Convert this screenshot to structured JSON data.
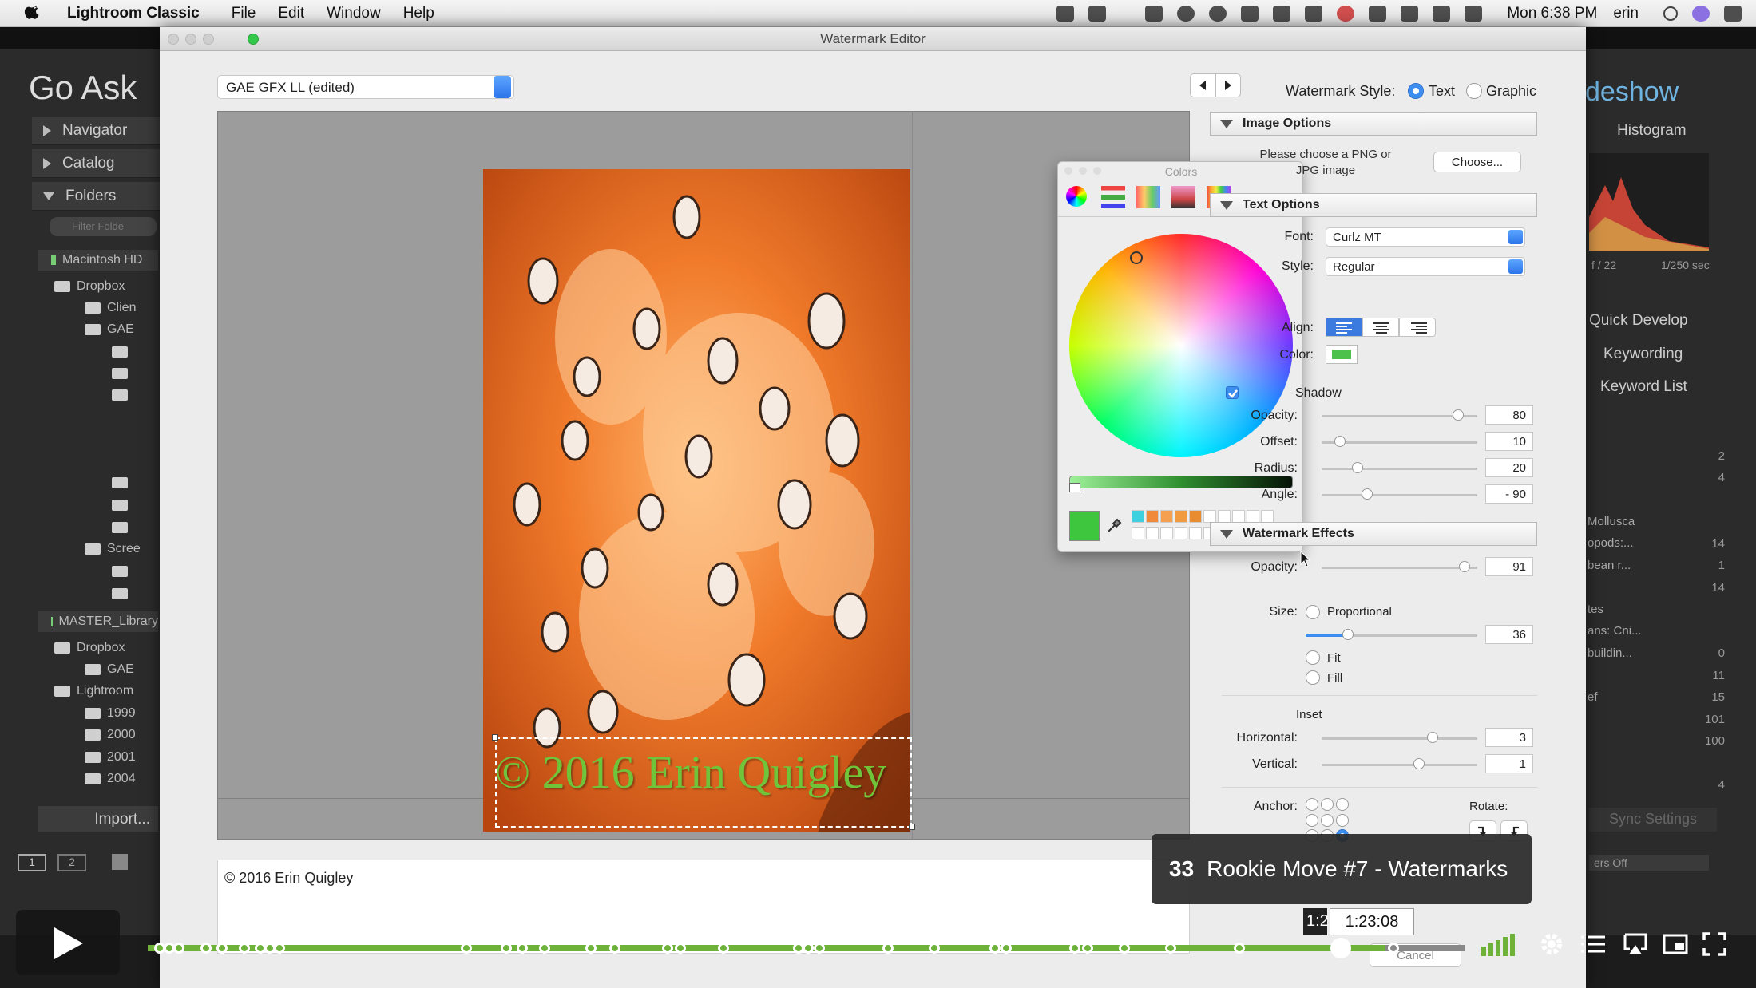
{
  "menubar": {
    "app_name": "Lightroom Classic",
    "items": [
      "File",
      "Edit",
      "Window",
      "Help"
    ],
    "clock": "Mon 6:38 PM",
    "user": "erin"
  },
  "lightroom": {
    "identity_plate": "Go Ask",
    "module_right": "deshow",
    "left_panels": [
      "Navigator",
      "Catalog",
      "Folders"
    ],
    "filter_placeholder": "Filter Folde",
    "volumes": [
      "Macintosh HD",
      "MASTER_Library"
    ],
    "tree": [
      "Dropbox",
      "Clien",
      "GAE",
      "Scree",
      "Dropbox",
      "GAE",
      "Lightroom",
      "1999",
      "2000",
      "2001",
      "2004"
    ],
    "import_label": "Import...",
    "right_panels": [
      "Histogram",
      "Quick Develop",
      "Keywording",
      "Keyword List"
    ],
    "histogram_info": [
      "f / 22",
      "1/250 sec"
    ],
    "keyword_labels": [
      "Mollusca",
      "opods:...",
      "bean r...",
      "tes",
      "ans: Cni...",
      "buildin...",
      "ef"
    ],
    "keyword_counts": [
      "2",
      "4",
      "14",
      "1",
      "14",
      "0",
      "11",
      "15",
      "101",
      "100",
      "4"
    ],
    "sync_label": "Sync Settings",
    "filter_off": "ers Off",
    "filmstrip_pages": [
      "1",
      "2"
    ]
  },
  "dialog": {
    "title": "Watermark Editor",
    "preset": "GAE GFX LL (edited)",
    "watermark_style_label": "Watermark Style:",
    "style_text": "Text",
    "style_graphic": "Graphic",
    "style_selected": "Text",
    "watermark_text": "© 2016 Erin Quigley",
    "caption_value": "© 2016 Erin Quigley",
    "cancel_label": "Cancel"
  },
  "colors_panel": {
    "title": "Colors",
    "current_color": "#3ec63e",
    "swatches": [
      "#3fd0e0",
      "#f08a3a",
      "#f5a050",
      "#f29a40",
      "#e98c30"
    ]
  },
  "image_options": {
    "header": "Image Options",
    "prompt": "Please choose a PNG or JPG image",
    "choose_label": "Choose..."
  },
  "text_options": {
    "header": "Text Options",
    "font_label": "Font:",
    "font_value": "Curlz MT",
    "style_label": "Style:",
    "style_value": "Regular",
    "align_label": "Align:",
    "color_label": "Color:",
    "color_value": "#4cc24c",
    "shadow_label": "Shadow",
    "shadow_checked": true,
    "shadow": [
      {
        "label": "Opacity:",
        "value": "80"
      },
      {
        "label": "Offset:",
        "value": "10"
      },
      {
        "label": "Radius:",
        "value": "20"
      },
      {
        "label": "Angle:",
        "value": "- 90"
      }
    ]
  },
  "watermark_effects": {
    "header": "Watermark Effects",
    "opacity_label": "Opacity:",
    "opacity_value": "91",
    "size_label": "Size:",
    "size_proportional": "Proportional",
    "size_value": "36",
    "size_fit": "Fit",
    "size_fill": "Fill",
    "inset_label": "Inset",
    "horizontal_label": "Horizontal:",
    "horizontal_value": "3",
    "vertical_label": "Vertical:",
    "vertical_value": "1",
    "anchor_label": "Anchor:",
    "rotate_label": "Rotate:"
  },
  "video": {
    "chapter_number": "33",
    "chapter_title": "Rookie Move #7 - Watermarks",
    "hover_time": "1:23:08",
    "current_time_fragment": "1:2"
  }
}
